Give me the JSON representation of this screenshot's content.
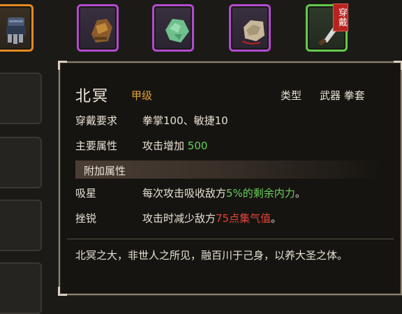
{
  "slots": [
    {
      "name": "gauntlet",
      "icon": "gauntlet-icon",
      "rarity_color": "#e58a1f"
    },
    {
      "name": "leather-glove",
      "icon": "leather-glove-icon",
      "rarity_color": "#b04ccf"
    },
    {
      "name": "jade-stone",
      "icon": "jade-stone-icon",
      "rarity_color": "#b04ccf"
    },
    {
      "name": "pouch",
      "icon": "pouch-icon",
      "rarity_color": "#b04ccf"
    },
    {
      "name": "blade",
      "icon": "blade-icon",
      "rarity_color": "#63c94a",
      "badge": "穿戴"
    }
  ],
  "tooltip": {
    "name": "北冥",
    "grade": "甲级",
    "type_label": "类型",
    "type_value": "武器 拳套",
    "requirement_label": "穿戴要求",
    "requirement_value": "拳掌100、敏捷10",
    "main_attr_label": "主要属性",
    "main_attr_prefix": "攻击增加 ",
    "main_attr_value": "500",
    "extra_section_title": "附加属性",
    "extra": [
      {
        "label": "吸星",
        "prefix": "每次攻击吸收敌方",
        "highlight": "5%的剩余内力",
        "suffix": "。",
        "highlight_color": "#67cf5c"
      },
      {
        "label": "挫锐",
        "prefix": "攻击时减少敌方",
        "highlight": "75点集气值",
        "suffix": "。",
        "highlight_color": "#e0443a"
      }
    ],
    "description": "北冥之大，非世人之所见，融百川于己身，以养大圣之体。"
  }
}
